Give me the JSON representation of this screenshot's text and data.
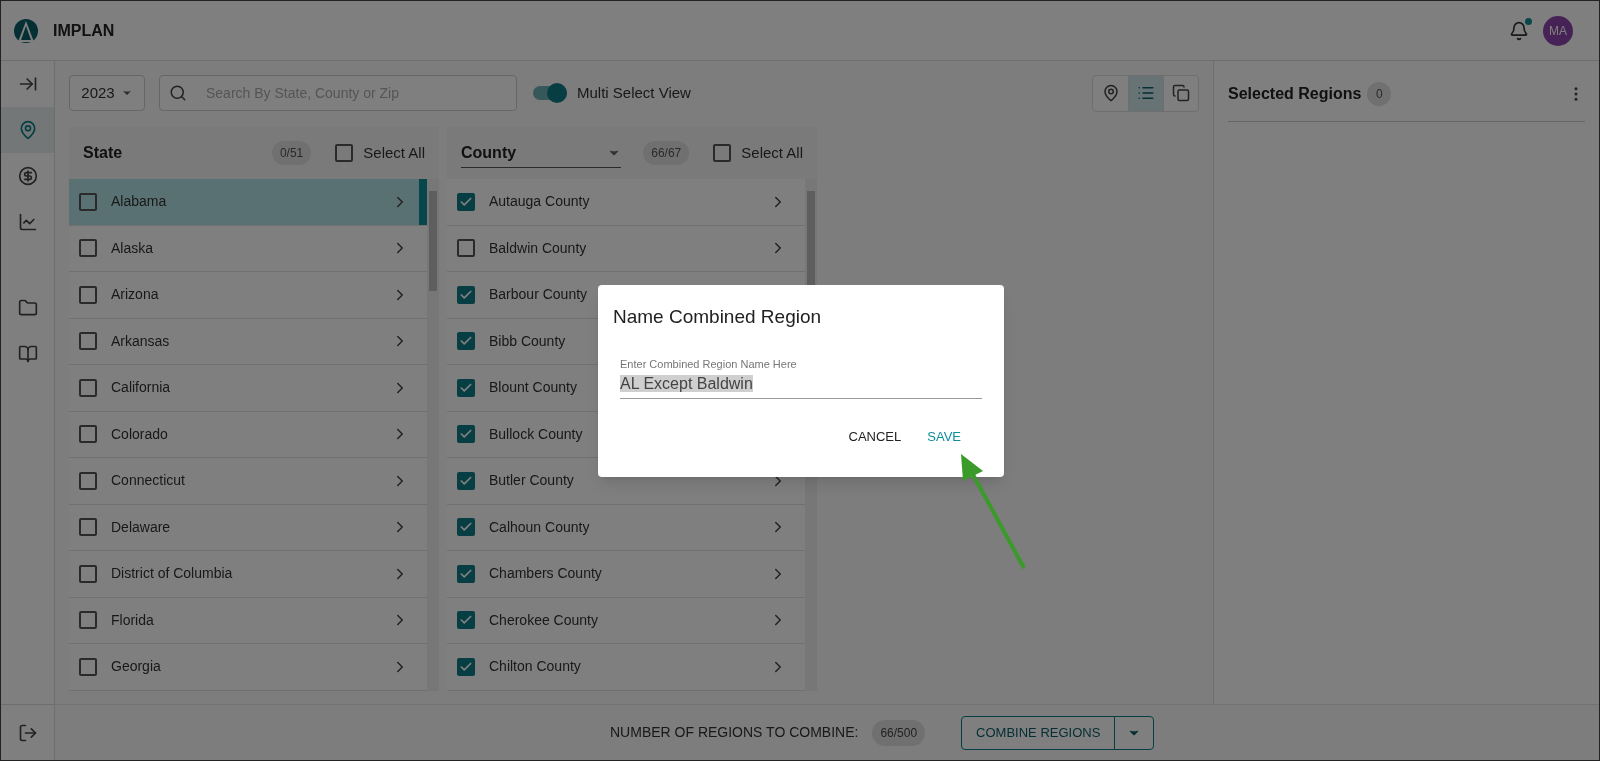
{
  "header": {
    "brand": "IMPLAN",
    "avatar": "MA",
    "notification": true
  },
  "sidebar": {
    "items": [
      {
        "kind": "expand",
        "selected": false
      },
      {
        "kind": "map",
        "selected": true
      },
      {
        "kind": "money",
        "selected": false
      },
      {
        "kind": "chart",
        "selected": false
      },
      {
        "kind": "folder",
        "selected": false
      },
      {
        "kind": "book",
        "selected": false
      }
    ]
  },
  "toolbar": {
    "year": "2023",
    "search": {
      "placeholder": "Search By State, County or Zip"
    },
    "toggle": {
      "label": "Multi Select View",
      "on": true
    },
    "views": [
      {
        "kind": "map",
        "selected": false
      },
      {
        "kind": "list",
        "selected": true
      },
      {
        "kind": "stack",
        "selected": false
      }
    ]
  },
  "state_panel": {
    "title": "State",
    "count": "0/51",
    "select_all": {
      "label": "Select All",
      "checked": false
    },
    "rows": [
      {
        "name": "Alabama",
        "checked": false,
        "selected": true
      },
      {
        "name": "Alaska",
        "checked": false,
        "selected": false
      },
      {
        "name": "Arizona",
        "checked": false,
        "selected": false
      },
      {
        "name": "Arkansas",
        "checked": false,
        "selected": false
      },
      {
        "name": "California",
        "checked": false,
        "selected": false
      },
      {
        "name": "Colorado",
        "checked": false,
        "selected": false
      },
      {
        "name": "Connecticut",
        "checked": false,
        "selected": false
      },
      {
        "name": "Delaware",
        "checked": false,
        "selected": false
      },
      {
        "name": "District of Columbia",
        "checked": false,
        "selected": false
      },
      {
        "name": "Florida",
        "checked": false,
        "selected": false
      },
      {
        "name": "Georgia",
        "checked": false,
        "selected": false
      }
    ]
  },
  "county_panel": {
    "title": "County",
    "count": "66/67",
    "select_all": {
      "label": "Select All",
      "checked": false
    },
    "rows": [
      {
        "name": "Autauga County",
        "checked": true
      },
      {
        "name": "Baldwin County",
        "checked": false
      },
      {
        "name": "Barbour County",
        "checked": true
      },
      {
        "name": "Bibb County",
        "checked": true
      },
      {
        "name": "Blount County",
        "checked": true
      },
      {
        "name": "Bullock County",
        "checked": true
      },
      {
        "name": "Butler County",
        "checked": true
      },
      {
        "name": "Calhoun County",
        "checked": true
      },
      {
        "name": "Chambers County",
        "checked": true
      },
      {
        "name": "Cherokee County",
        "checked": true
      },
      {
        "name": "Chilton County",
        "checked": true
      }
    ]
  },
  "selected_regions": {
    "title": "Selected Regions",
    "count": "0"
  },
  "footer": {
    "label": "NUMBER OF REGIONS TO COMBINE:",
    "count": "66/500",
    "button": "COMBINE REGIONS"
  },
  "dialog": {
    "title": "Name Combined Region",
    "field_label": "Enter Combined Region Name Here",
    "value": "AL Except Baldwin",
    "buttons": [
      {
        "label": "CANCEL",
        "kind": "plain"
      },
      {
        "label": "SAVE",
        "kind": "primary"
      }
    ]
  }
}
